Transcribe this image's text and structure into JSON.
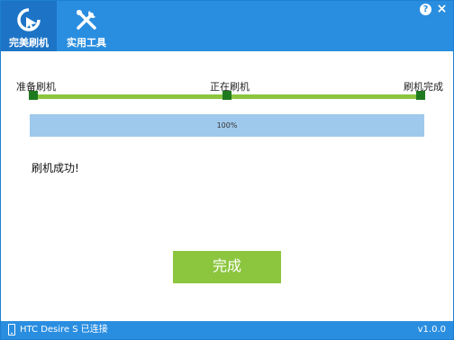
{
  "nav": {
    "tabs": [
      {
        "label": "完美刷机",
        "icon": "refresh-arrow-icon",
        "active": true
      },
      {
        "label": "实用工具",
        "icon": "tools-icon",
        "active": false
      }
    ]
  },
  "window_controls": {
    "help": "?",
    "close": "×"
  },
  "stages": {
    "prepare": "准备刷机",
    "flashing": "正在刷机",
    "done": "刷机完成"
  },
  "progress": {
    "percent": 100,
    "label": "100%"
  },
  "status_message": "刷机成功!",
  "finish_button_label": "完成",
  "statusbar": {
    "device": "HTC Desire S 已连接",
    "version": "v1.0.0",
    "icon": "phone-icon"
  },
  "colors": {
    "accent": "#2a8ee0",
    "success": "#8cc63f",
    "progress_fill": "#9fc9ec"
  }
}
